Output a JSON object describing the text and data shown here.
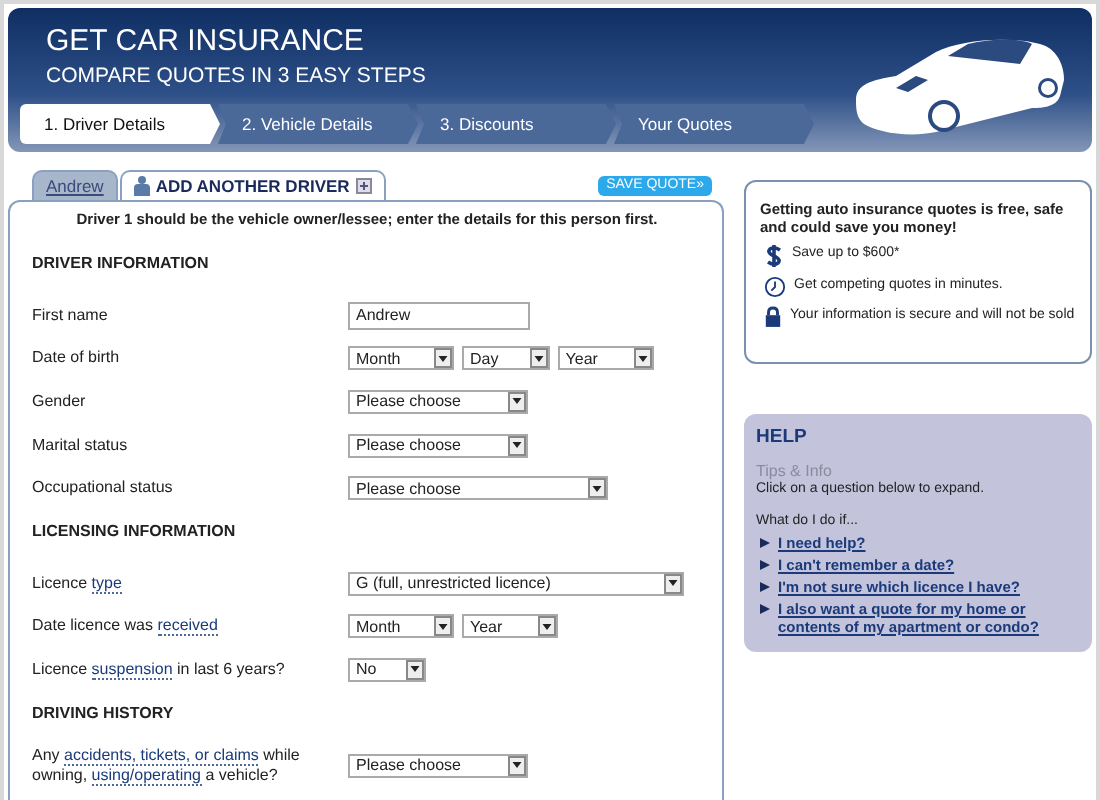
{
  "header": {
    "title": "GET CAR INSURANCE",
    "subtitle": "COMPARE QUOTES IN 3 EASY STEPS"
  },
  "steps": [
    {
      "label": "1. Driver Details",
      "selected": true
    },
    {
      "label": "2. Vehicle Details",
      "selected": false
    },
    {
      "label": "3. Discounts",
      "selected": false
    },
    {
      "label": "Your Quotes",
      "selected": false
    }
  ],
  "driver_tabs": [
    {
      "label": "Andrew",
      "selected": true,
      "kind": "driver"
    },
    {
      "label": "ADD ANOTHER DRIVER",
      "selected": false,
      "kind": "add"
    }
  ],
  "save_button": "SAVE QUOTE»",
  "intro": "Driver 1 should be the vehicle owner/lessee; enter the details for this person first.",
  "sections": [
    {
      "heading": "DRIVER INFORMATION",
      "rows": [
        {
          "label": [
            {
              "text": "First name",
              "kind": "plain"
            }
          ],
          "controls": [
            {
              "kind": "text",
              "value": "Andrew"
            }
          ]
        },
        {
          "label": [
            {
              "text": "Date of birth",
              "kind": "plain"
            }
          ],
          "controls": [
            {
              "kind": "select",
              "value": "Month"
            },
            {
              "kind": "select",
              "value": "Day"
            },
            {
              "kind": "select",
              "value": "Year"
            }
          ]
        },
        {
          "label": [
            {
              "text": "Gender",
              "kind": "plain"
            }
          ],
          "controls": [
            {
              "kind": "select",
              "value": "Please choose"
            }
          ]
        },
        {
          "label": [
            {
              "text": "Marital status",
              "kind": "plain"
            }
          ],
          "controls": [
            {
              "kind": "select",
              "value": "Please choose"
            }
          ]
        },
        {
          "label": [
            {
              "text": "Occupational status",
              "kind": "plain"
            }
          ],
          "controls": [
            {
              "kind": "wide-select",
              "value": "Please choose"
            }
          ]
        }
      ]
    },
    {
      "heading": "LICENSING INFORMATION",
      "rows": [
        {
          "label": [
            {
              "text": "Licence ",
              "kind": "plain"
            },
            {
              "text": "type",
              "kind": "term"
            }
          ],
          "controls": [
            {
              "kind": "select",
              "value": "G (full, unrestricted licence)"
            }
          ]
        },
        {
          "label": [
            {
              "text": "Date licence was ",
              "kind": "plain"
            },
            {
              "text": "received",
              "kind": "term"
            }
          ],
          "controls": [
            {
              "kind": "select",
              "value": "Month"
            },
            {
              "kind": "select",
              "value": "Year"
            }
          ]
        },
        {
          "label": [
            {
              "text": "Licence ",
              "kind": "plain"
            },
            {
              "text": "suspension",
              "kind": "term"
            },
            {
              "text": " in last 6 years?",
              "kind": "plain"
            }
          ],
          "controls": [
            {
              "kind": "select",
              "value": "No"
            }
          ]
        }
      ]
    },
    {
      "heading": "DRIVING HISTORY",
      "rows": [
        {
          "label": [
            {
              "text": "Any ",
              "kind": "plain"
            },
            {
              "text": "accidents, tickets, or claims",
              "kind": "term"
            },
            {
              "text": " while owning, ",
              "kind": "plain"
            },
            {
              "text": "using/operating",
              "kind": "term"
            },
            {
              "text": " a vehicle?",
              "kind": "plain"
            }
          ],
          "controls": [
            {
              "kind": "select",
              "value": "Please choose"
            }
          ]
        }
      ]
    }
  ],
  "benefits": {
    "title": "Getting auto insurance quotes is free, safe and could save you money!",
    "items": [
      {
        "kind": "dollar",
        "text": "Save up to $600*"
      },
      {
        "kind": "clock",
        "text": "Get competing quotes in minutes."
      },
      {
        "kind": "lock",
        "text": "Your information is secure and will not be sold"
      }
    ]
  },
  "help": {
    "title": "HELP",
    "subtitle": "Tips & Info",
    "instruction": "Click on a question below to expand.",
    "prompt": "What do I do if...",
    "questions": [
      {
        "text": "I need help?",
        "expanded": false
      },
      {
        "text": "I can't remember a date?",
        "expanded": false
      },
      {
        "text": "I'm not sure which licence I have?",
        "expanded": false
      },
      {
        "text": "I also want a quote for my home or contents of my apartment or condo?",
        "expanded": false
      }
    ]
  }
}
